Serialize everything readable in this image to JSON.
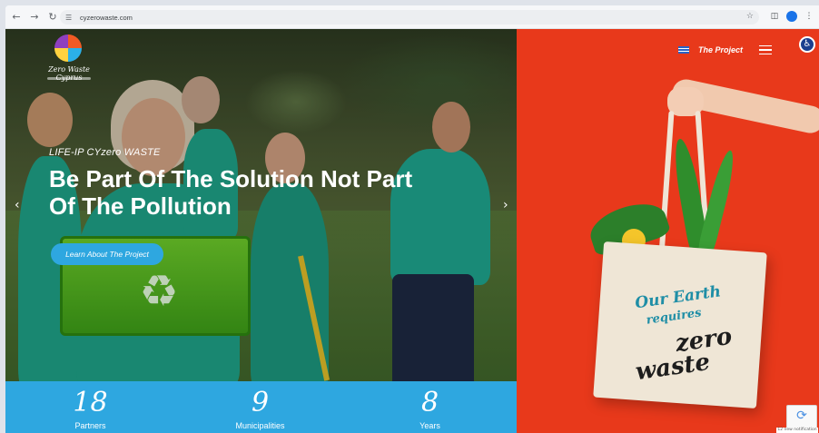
{
  "browser": {
    "url": "cyzerowaste.com",
    "back_icon": "arrow-left-icon",
    "forward_icon": "arrow-right-icon",
    "reload_icon": "reload-icon",
    "profile_initial": "•"
  },
  "site": {
    "logo_text": "Zero Waste Cyprus"
  },
  "nav": {
    "project_label": "The Project"
  },
  "hero": {
    "eyebrow": "LIFE-IP CYzero WASTE",
    "headline": "Be Part Of The Solution Not Part Of The Pollution",
    "cta_label": "Learn About The Project"
  },
  "stats": [
    {
      "value": "18",
      "label": "Partners"
    },
    {
      "value": "9",
      "label": "Municipalities"
    },
    {
      "value": "8",
      "label": "Years"
    }
  ],
  "bag": {
    "line1": "Our Earth",
    "line2": "requires",
    "line3": "zero",
    "line4": "waste"
  },
  "recaptcha": {
    "note": "12 new notification"
  },
  "colors": {
    "accent_blue": "#2ea7e0",
    "brand_red": "#e8391b"
  }
}
